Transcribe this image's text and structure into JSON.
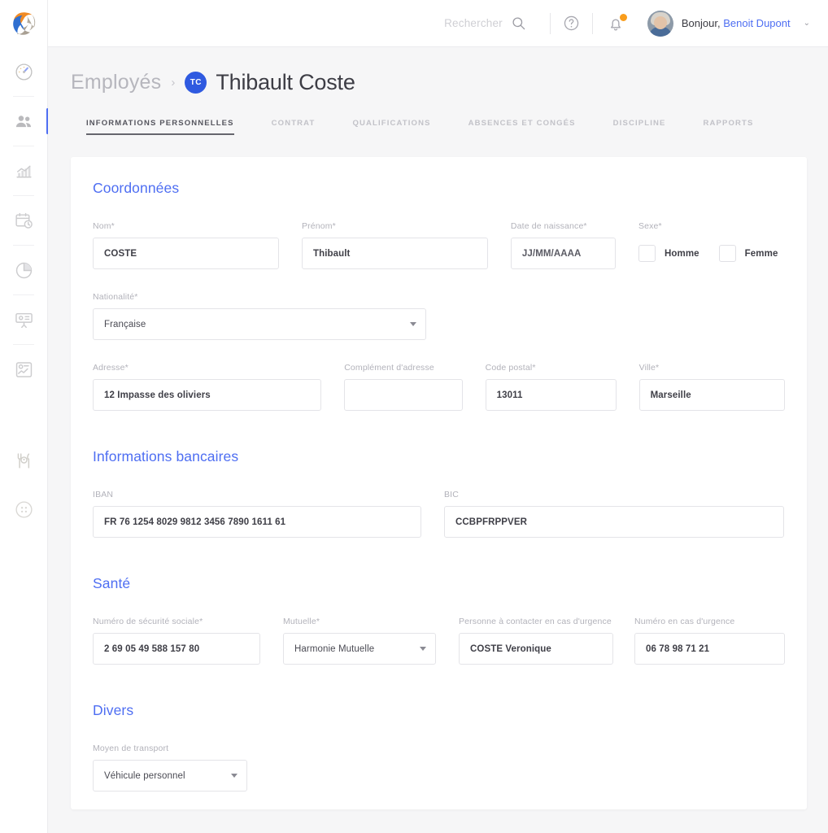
{
  "topbar": {
    "logo_name": "company-logo",
    "search_placeholder": "Rechercher",
    "search_icon": "search-icon",
    "help_icon": "help-circle-icon",
    "bell_icon": "notification-bell-icon",
    "greeting": "Bonjour,",
    "user_name": "Benoit Dupont",
    "caret": "⌄"
  },
  "sidebar": {
    "items": [
      {
        "icon": "dashboard-gauge-icon",
        "active": false
      },
      {
        "icon": "employees-people-icon",
        "active": true
      },
      {
        "icon": "analytics-bar-chart-icon",
        "active": false
      },
      {
        "icon": "planning-calendar-clock-icon",
        "active": false
      },
      {
        "icon": "pie-chart-icon",
        "active": false
      },
      {
        "icon": "presentation-screen-icon",
        "active": false
      },
      {
        "icon": "reports-document-icon",
        "active": false
      },
      {
        "icon": "restaurant-cutlery-icon",
        "active": false
      },
      {
        "icon": "apps-grid-icon",
        "active": false
      }
    ]
  },
  "breadcrumb": {
    "parent": "Employés",
    "separator": "›",
    "initials": "TC",
    "title": "Thibault Coste"
  },
  "tabs": [
    {
      "label": "Informations personnelles",
      "active": true
    },
    {
      "label": "Contrat",
      "active": false
    },
    {
      "label": "Qualifications",
      "active": false
    },
    {
      "label": "Absences et congés",
      "active": false
    },
    {
      "label": "Discipline",
      "active": false
    },
    {
      "label": "Rapports",
      "active": false
    }
  ],
  "sections": {
    "coordonnees": {
      "title": "Coordonnées",
      "nom_label": "Nom*",
      "nom_value": "COSTE",
      "prenom_label": "Prénom*",
      "prenom_value": "Thibault",
      "naissance_label": "Date de naissance*",
      "naissance_placeholder": "JJ/MM/AAAA",
      "sexe_label": "Sexe*",
      "sexe_homme": "Homme",
      "sexe_femme": "Femme",
      "nationalite_label": "Nationalité*",
      "nationalite_value": "Française",
      "adresse_label": "Adresse*",
      "adresse_value": "12 Impasse des oliviers",
      "complement_label": "Complément d'adresse",
      "complement_value": "",
      "cp_label": "Code postal*",
      "cp_value": "13011",
      "ville_label": "Ville*",
      "ville_value": "Marseille"
    },
    "bancaires": {
      "title": "Informations bancaires",
      "iban_label": "IBAN",
      "iban_value": "FR 76 1254 8029 9812 3456 7890 1611 61",
      "bic_label": "BIC",
      "bic_value": "CCBPFRPPVER"
    },
    "sante": {
      "title": "Santé",
      "secu_label": "Numéro de sécurité sociale*",
      "secu_value": "2 69 05 49 588 157 80",
      "mutuelle_label": "Mutuelle*",
      "mutuelle_value": "Harmonie Mutuelle",
      "urgence_personne_label": "Personne à contacter en cas d'urgence",
      "urgence_personne_value": "COSTE Veronique",
      "urgence_numero_label": "Numéro en cas d'urgence",
      "urgence_numero_value": "06 78 98 71 21"
    },
    "divers": {
      "title": "Divers",
      "transport_label": "Moyen de transport",
      "transport_value": "Véhicule personnel"
    }
  },
  "colors": {
    "accent_blue": "#4e6ef2",
    "badge_blue": "#2f5ae0",
    "notification_orange": "#f99d1c",
    "page_bg": "#f6f6f7",
    "border": "#e4e4e8"
  }
}
